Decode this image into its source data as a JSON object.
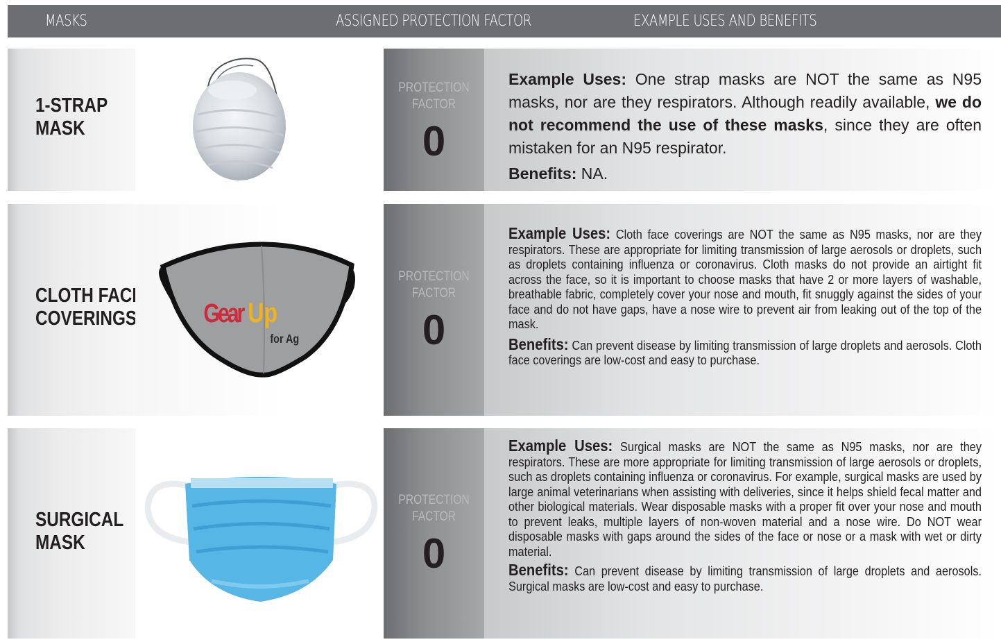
{
  "header": {
    "col1": "MASKS",
    "col2": "ASSIGNED PROTECTION FACTOR",
    "col3": "EXAMPLE USES AND BENEFITS"
  },
  "rows": [
    {
      "name_line1": "1-STRAP",
      "name_line2": "MASK",
      "pf_label_line1": "PROTECTION",
      "pf_label_line2": "FACTOR",
      "pf_value": "0",
      "uses_heading": "Example Uses:",
      "uses_text_a": " One strap masks are NOT the same as N95 masks, nor are they respirators. Although readily available, ",
      "uses_text_bold": "we do not recommend the use of these masks",
      "uses_text_b": ", since they are often mistaken for an N95 respirator.",
      "benefits_heading": "Benefits:",
      "benefits_text": " NA."
    },
    {
      "name_line1": "CLOTH FACE",
      "name_line2": "COVERINGS",
      "pf_label_line1": "PROTECTION",
      "pf_label_line2": "FACTOR",
      "pf_value": "0",
      "image_logo_gear": "Gear",
      "image_logo_up": "Up",
      "image_logo_forag": "for Ag",
      "uses_heading": "Example Uses:",
      "uses_text": " Cloth face coverings are NOT the same as N95 masks, nor are they respirators.  These are appropriate for limiting transmission of large aerosols or droplets, such as droplets containing influenza or coronavirus.  Cloth masks do not provide an airtight fit across the face, so it is important to choose masks that have 2 or more layers of washable, breathable fabric, completely cover your nose and mouth, fit snuggly against the sides of your face and do not have gaps, have a nose wire to prevent air from leaking out of the top of the mask.",
      "benefits_heading": "Benefits:",
      "benefits_text": " Can prevent disease by limiting transmission of large droplets and aerosols. Cloth face coverings are low-cost and easy to purchase."
    },
    {
      "name_line1": "SURGICAL",
      "name_line2": "MASK",
      "pf_label_line1": "PROTECTION",
      "pf_label_line2": "FACTOR",
      "pf_value": "0",
      "uses_heading": "Example Uses:",
      "uses_text": " Surgical masks are NOT the same as N95 masks, nor are they respirators. These are more appropriate for limiting transmission of large aerosols or droplets, such as droplets containing influenza or coronavirus. For example, surgical masks are used by large animal veterinarians when assisting with deliveries, since it helps shield fecal matter and other biological materials.  Wear disposable  masks with a proper fit over your nose and mouth to prevent leaks, multiple layers of non-woven material and a nose wire.  Do NOT wear disposable masks with gaps around the sides of the face or nose or a mask with wet or dirty material.",
      "benefits_heading": "Benefits:",
      "benefits_text": " Can prevent disease by limiting transmission of large droplets and aerosols. Surgical masks are low-cost and easy to purchase."
    }
  ]
}
